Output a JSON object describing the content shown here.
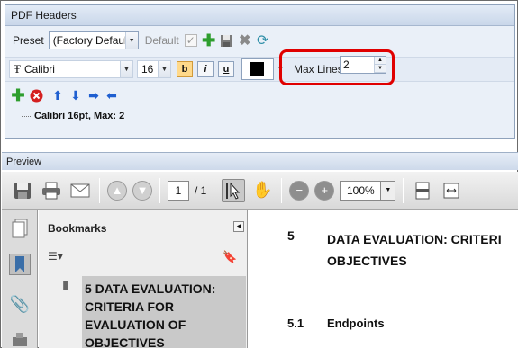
{
  "headers_panel": {
    "title": "PDF Headers",
    "preset_label": "Preset",
    "preset_value": "(Factory Default)",
    "default_label": "Default",
    "font_name": "Calibri",
    "font_size": "16",
    "bold_label": "b",
    "italic_label": "i",
    "underline_label": "u",
    "color": "#000000",
    "max_lines_label": "Max Lines:",
    "max_lines_value": "2",
    "tree_item": "Calibri 16pt, Max: 2"
  },
  "preview": {
    "label": "Preview",
    "page_current": "1",
    "page_total": "/ 1",
    "zoom": "100%",
    "bookmarks_label": "Bookmarks",
    "bookmark_item_lines": [
      "5 DATA EVALUATION:",
      "CRITERIA FOR",
      "EVALUATION OF",
      "OBJECTIVES"
    ],
    "doc_section_number": "5",
    "doc_section_title_lines": [
      "DATA EVALUATION: CRITERI",
      "OBJECTIVES"
    ],
    "doc_subsection_number": "5.1",
    "doc_subsection_title": "Endpoints"
  },
  "colors": {
    "highlight": "#e00000",
    "add": "#2e9e2e",
    "remove": "#d42020",
    "arrow": "#1f5fd0"
  }
}
